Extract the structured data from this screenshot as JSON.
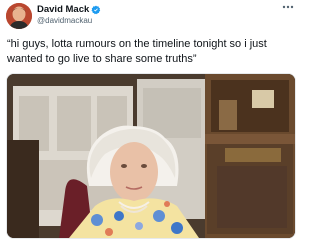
{
  "tweet": {
    "display_name": "David Mack",
    "handle": "@davidmackau",
    "text": "“hi guys, lotta rumours on the timeline tonight so i just wanted to go live to share some truths”",
    "verified": true
  },
  "icons": {
    "avatar": "avatar-photo",
    "verified": "verified-badge-icon",
    "more": "more-options-icon"
  },
  "colors": {
    "text_primary": "#0f1419",
    "text_secondary": "#536471",
    "verified_blue": "#1d9bf0"
  }
}
